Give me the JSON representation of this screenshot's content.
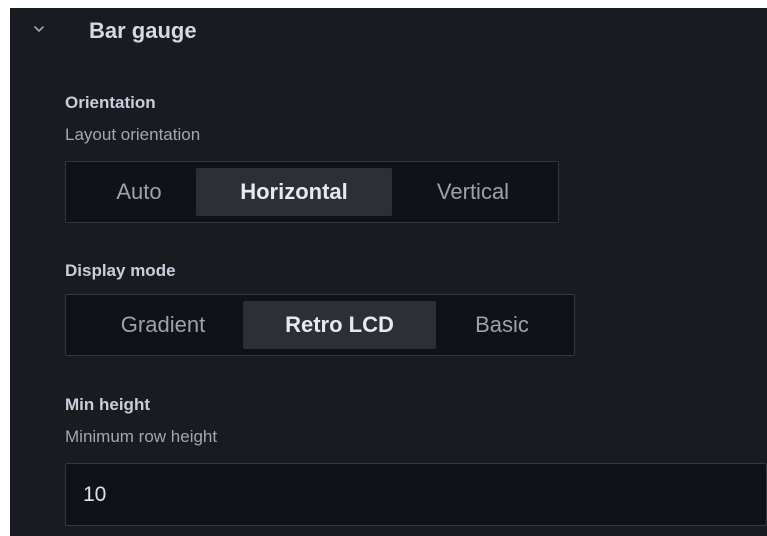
{
  "section": {
    "title": "Bar gauge",
    "icon": "chevron-down-icon"
  },
  "orientation": {
    "label": "Orientation",
    "description": "Layout orientation",
    "options": [
      "Auto",
      "Horizontal",
      "Vertical"
    ],
    "selected": "Horizontal"
  },
  "display_mode": {
    "label": "Display mode",
    "options": [
      "Gradient",
      "Retro LCD",
      "Basic"
    ],
    "selected": "Retro LCD"
  },
  "min_height": {
    "label": "Min height",
    "description": "Minimum row height",
    "value": "10"
  },
  "colors": {
    "panel_bg": "#181b1f",
    "input_bg": "#111217",
    "active_option_bg": "#2c2f35",
    "border": "#34373d"
  }
}
